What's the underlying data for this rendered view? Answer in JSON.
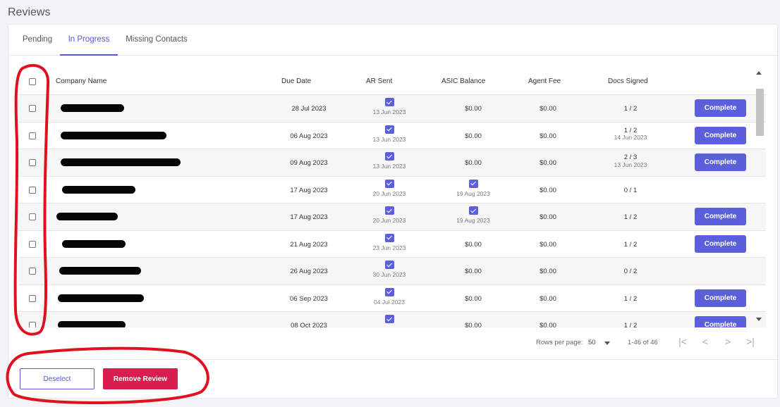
{
  "page": {
    "title": "Reviews"
  },
  "tabs": [
    {
      "label": "Pending"
    },
    {
      "label": "In Progress"
    },
    {
      "label": "Missing Contacts"
    }
  ],
  "table": {
    "headers": {
      "company": "Company Name",
      "due": "Due Date",
      "ar": "AR Sent",
      "asic": "ASIC Balance",
      "agent": "Agent Fee",
      "docs": "Docs Signed"
    },
    "complete_label": "Complete",
    "rows": [
      {
        "due": "28 Jul 2023",
        "ar_date": "13 Jun 2023",
        "asic": "$0.00",
        "asic_date": "",
        "agent": "$0.00",
        "docs": "1 / 2",
        "docs_date": "",
        "complete": true
      },
      {
        "due": "06 Aug 2023",
        "ar_date": "13 Jun 2023",
        "asic": "$0.00",
        "asic_date": "",
        "agent": "$0.00",
        "docs": "1 / 2",
        "docs_date": "14 Jun 2023",
        "complete": true
      },
      {
        "due": "09 Aug 2023",
        "ar_date": "13 Jun 2023",
        "asic": "$0.00",
        "asic_date": "",
        "agent": "$0.00",
        "docs": "2 / 3",
        "docs_date": "13 Jun 2023",
        "complete": true
      },
      {
        "due": "17 Aug 2023",
        "ar_date": "20 Jun 2023",
        "asic": "",
        "asic_date": "19 Aug 2023",
        "agent": "$0.00",
        "docs": "0 / 1",
        "docs_date": "",
        "complete": false
      },
      {
        "due": "17 Aug 2023",
        "ar_date": "20 Jun 2023",
        "asic": "",
        "asic_date": "19 Aug 2023",
        "agent": "$0.00",
        "docs": "1 / 2",
        "docs_date": "",
        "complete": true
      },
      {
        "due": "21 Aug 2023",
        "ar_date": "23 Jun 2023",
        "asic": "$0.00",
        "asic_date": "",
        "agent": "$0.00",
        "docs": "1 / 2",
        "docs_date": "",
        "complete": true
      },
      {
        "due": "26 Aug 2023",
        "ar_date": "30 Jun 2023",
        "asic": "$0.00",
        "asic_date": "",
        "agent": "$0.00",
        "docs": "0 / 2",
        "docs_date": "",
        "complete": false
      },
      {
        "due": "06 Sep 2023",
        "ar_date": "04 Jul 2023",
        "asic": "$0.00",
        "asic_date": "",
        "agent": "$0.00",
        "docs": "1 / 2",
        "docs_date": "",
        "complete": true
      },
      {
        "due": "08 Oct 2023",
        "ar_date": "",
        "asic": "$0.00",
        "asic_date": "",
        "agent": "$0.00",
        "docs": "1 / 2",
        "docs_date": "",
        "complete": true
      }
    ]
  },
  "footer": {
    "rows_per_page_label": "Rows per page:",
    "rows_per_page_value": "50",
    "range": "1-46 of 46"
  },
  "actions": {
    "deselect": "Deselect",
    "remove": "Remove Review"
  },
  "colors": {
    "accent": "#5b5fdc",
    "danger": "#d61f4f",
    "annotation": "#e0101e"
  }
}
